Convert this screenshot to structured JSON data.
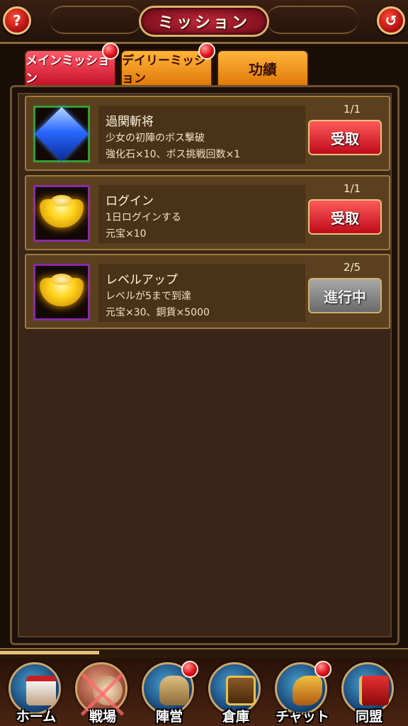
{
  "header": {
    "title": "ミッション",
    "help_label": "?",
    "back_label": "↺"
  },
  "tabs": [
    {
      "label": "メインミッション",
      "active": true,
      "has_notification": true
    },
    {
      "label": "デイリーミッション",
      "active": false,
      "has_notification": true
    },
    {
      "label": "功績",
      "active": false,
      "has_notification": false
    }
  ],
  "missions": [
    {
      "title": "過関斬将",
      "description": "少女の初陣のボス撃破",
      "reward": "強化石×10、ボス挑戦回数×1",
      "progress": "1/1",
      "button": "受取",
      "icon": "blue-gem-icon",
      "frame_color": "#30a030"
    },
    {
      "title": "ログイン",
      "description": "1日ログインする",
      "reward": "元宝×10",
      "progress": "1/1",
      "button": "受取",
      "icon": "gold-ingot-icon",
      "frame_color": "#8a2aa8"
    },
    {
      "title": "レベルアップ",
      "description": "レベルが5まで到達",
      "reward": "元宝×30、銅貨×5000",
      "progress": "2/5",
      "button": "進行中",
      "icon": "gold-ingot-icon",
      "frame_color": "#8a2aa8"
    }
  ],
  "bottom_nav": [
    {
      "label": "ホーム",
      "icon": "castle-icon",
      "locked": false,
      "has_notification": false
    },
    {
      "label": "戦場",
      "icon": "war-drum-icon",
      "locked": true,
      "has_notification": false
    },
    {
      "label": "陣営",
      "icon": "helmet-icon",
      "locked": false,
      "has_notification": true
    },
    {
      "label": "倉庫",
      "icon": "treasure-chest-icon",
      "locked": false,
      "has_notification": false
    },
    {
      "label": "チャット",
      "icon": "dragon-icon",
      "locked": false,
      "has_notification": true
    },
    {
      "label": "同盟",
      "icon": "banner-icon",
      "locked": false,
      "has_notification": false
    }
  ],
  "colors": {
    "claim_button": "#c00a1a",
    "progress_button": "#6a6a6a",
    "active_tab": "#c8122a",
    "inactive_tab": "#e07a0a"
  }
}
